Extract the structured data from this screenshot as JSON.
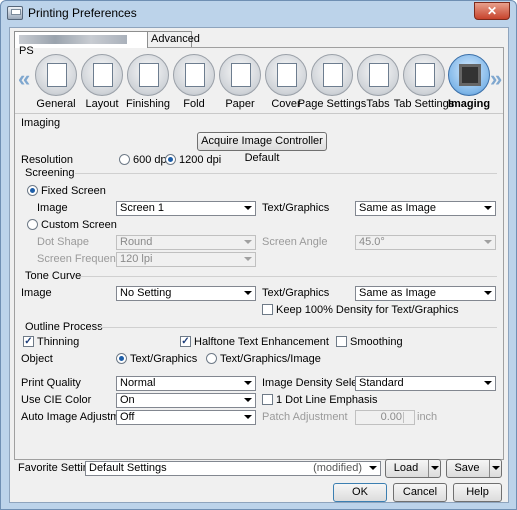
{
  "window": {
    "title": "Printing Preferences",
    "close": "✕"
  },
  "tabs": [
    {
      "label": "PS"
    },
    {
      "label": "Advanced"
    }
  ],
  "toolbar": {
    "items": [
      {
        "label": "General",
        "icon": "printer-icon"
      },
      {
        "label": "Layout",
        "icon": "layout-icon"
      },
      {
        "label": "Finishing",
        "icon": "finishing-icon"
      },
      {
        "label": "Fold",
        "icon": "fold-icon"
      },
      {
        "label": "Paper",
        "icon": "paper-icon"
      },
      {
        "label": "Cover",
        "icon": "cover-icon"
      },
      {
        "label": "Page Settings",
        "icon": "page-settings-icon"
      },
      {
        "label": "Tabs",
        "icon": "tabs-icon"
      },
      {
        "label": "Tab Settings",
        "icon": "tab-settings-icon"
      },
      {
        "label": "Imaging",
        "icon": "imaging-icon"
      }
    ],
    "left_arrow": "«",
    "right_arrow": "»"
  },
  "imaging": {
    "section_label": "Imaging",
    "acquire_button": "Acquire Image Controller Default",
    "resolution_label": "Resolution",
    "resolution_options": [
      "600 dpi",
      "1200 dpi"
    ]
  },
  "screening": {
    "section_label": "Screening",
    "fixed_screen": "Fixed Screen",
    "image_label": "Image",
    "image_value": "Screen 1",
    "textgraphics_label": "Text/Graphics",
    "textgraphics_value": "Same as Image",
    "custom_screen": "Custom Screen",
    "dot_shape_label": "Dot Shape",
    "dot_shape_value": "Round",
    "screen_angle_label": "Screen Angle",
    "screen_angle_value": "45.0°",
    "screen_frequency_label": "Screen Frequency",
    "screen_frequency_value": "120 lpi"
  },
  "tone_curve": {
    "section_label": "Tone Curve",
    "image_label": "Image",
    "image_value": "No Setting",
    "textgraphics_label": "Text/Graphics",
    "textgraphics_value": "Same as Image",
    "keep_density": "Keep 100% Density for Text/Graphics"
  },
  "outline": {
    "section_label": "Outline Process",
    "thinning": "Thinning",
    "halftone": "Halftone Text Enhancement",
    "smoothing": "Smoothing",
    "object_label": "Object",
    "object_options": [
      "Text/Graphics",
      "Text/Graphics/Image"
    ]
  },
  "quality": {
    "print_quality_label": "Print Quality",
    "print_quality_value": "Normal",
    "cie_label": "Use CIE Color",
    "cie_value": "On",
    "auto_adjust_label": "Auto Image Adjustment",
    "auto_adjust_value": "Off",
    "density_label": "Image Density Selection",
    "density_value": "Standard",
    "dot_line": "1 Dot Line Emphasis",
    "patch_label": "Patch Adjustment",
    "patch_value": "0.00",
    "patch_unit": "inch"
  },
  "favorite": {
    "label": "Favorite Setting",
    "value": "Default Settings",
    "modified": "(modified)",
    "load": "Load",
    "save": "Save"
  },
  "dialog": {
    "ok": "OK",
    "cancel": "Cancel",
    "help": "Help"
  }
}
